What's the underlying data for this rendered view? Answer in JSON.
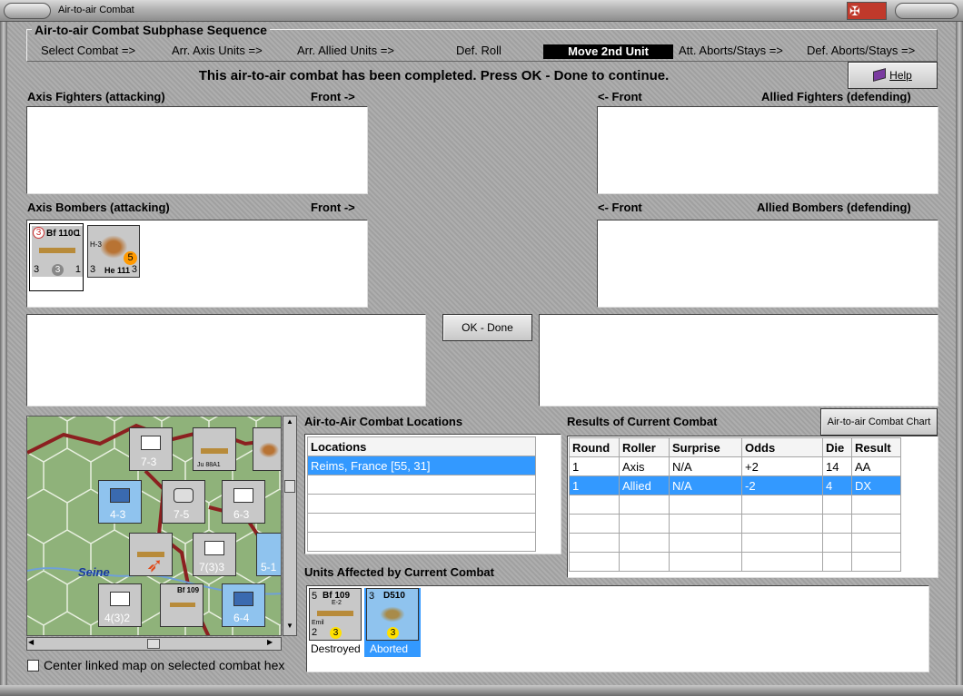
{
  "window": {
    "title": "Air-to-air Combat"
  },
  "sequence": {
    "title": "Air-to-air Combat Subphase Sequence",
    "steps": [
      "Select Combat =>",
      "Arr. Axis Units =>",
      "Arr. Allied Units =>",
      "Def. Roll",
      "Move 2nd Unit",
      "Att. Aborts/Stays =>",
      "Def. Aborts/Stays =>"
    ],
    "active_step": "Move 2nd Unit"
  },
  "message": "This air-to-air combat has been completed.  Press OK - Done to continue.",
  "help_label": "Help",
  "ok_done_label": "OK - Done",
  "front_right": "Front ->",
  "front_left": "<- Front",
  "axis_fighters_label": "Axis Fighters (attacking)",
  "allied_fighters_label": "Allied Fighters (defending)",
  "axis_bombers_label": "Axis Bombers (attacking)",
  "allied_bombers_label": "Allied Bombers (defending)",
  "axis_bombers": [
    {
      "name": "Bf 110C",
      "tl": "3",
      "tr": "1",
      "bl": "3",
      "bm": "3",
      "br": "1"
    },
    {
      "name": "He 111",
      "tl": "H-3",
      "badge": "5",
      "bl": "3",
      "br": "3"
    }
  ],
  "locations": {
    "title": "Air-to-Air Combat Locations",
    "header": "Locations",
    "items": [
      "Reims, France [55, 31]"
    ]
  },
  "results": {
    "title": "Results of Current Combat",
    "chart_button": "Air-to-air Combat Chart",
    "columns": [
      "Round",
      "Roller",
      "Surprise",
      "Odds",
      "Die",
      "Result"
    ],
    "rows": [
      [
        "1",
        "Axis",
        "N/A",
        "+2",
        "14",
        "AA"
      ],
      [
        "1",
        "Allied",
        "N/A",
        "-2",
        "4",
        "DX"
      ]
    ]
  },
  "affected": {
    "title": "Units Affected by Current Combat",
    "units": [
      {
        "name": "Bf 109",
        "sub": "E-2",
        "tl": "5",
        "bl": "2",
        "pilot": "Emil",
        "badge": "3",
        "status": "Destroyed"
      },
      {
        "name": "D510",
        "tl": "3",
        "badge": "3",
        "status": "Aborted"
      }
    ]
  },
  "map": {
    "river": "Seine",
    "counters": [
      "7-3",
      "7-5",
      "6-3",
      "4-3",
      "5-1",
      "7(3)3",
      "4(3)2",
      "6-4",
      "XXX",
      "XXXXX"
    ],
    "air_units": [
      "Ju 88A1",
      "He 111",
      "Bf 109",
      "Bf 110"
    ]
  },
  "center_map_label": "Center linked map on selected combat hex",
  "colors": {
    "accent": "#3399ff",
    "active_step_bg": "#000000",
    "map_green": "#8fb27a"
  }
}
